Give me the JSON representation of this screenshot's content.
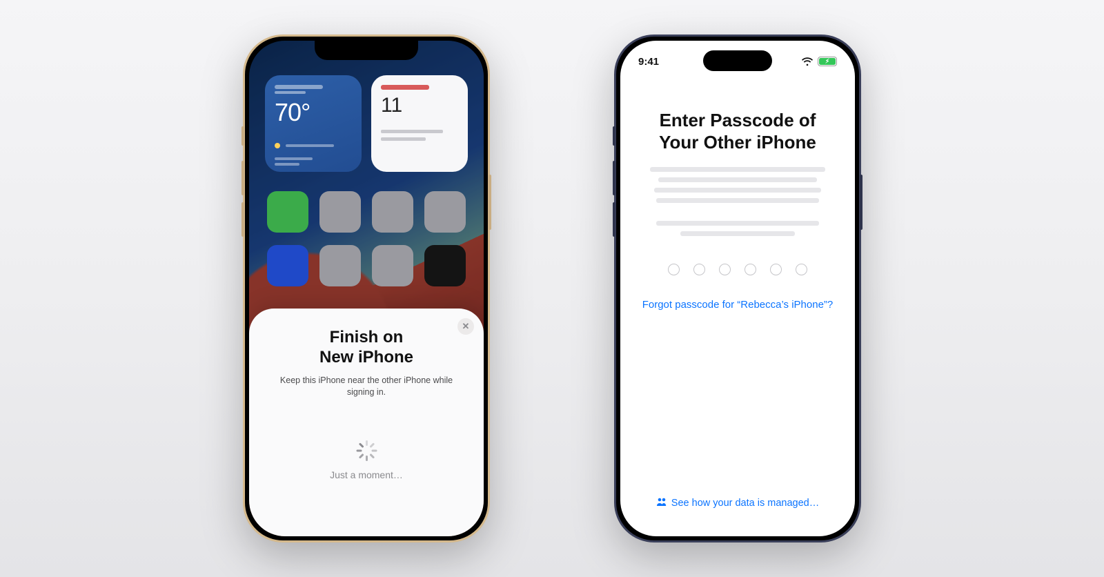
{
  "left_phone": {
    "weather": {
      "temperature": "70°"
    },
    "calendar": {
      "day": "11"
    },
    "app_colors": [
      "#3bab4a",
      "#9a9aa0",
      "#9a9aa0",
      "#9a9aa0",
      "#1f49c8",
      "#9a9aa0",
      "#9a9aa0",
      "#141414"
    ],
    "sheet": {
      "title_line1": "Finish on",
      "title_line2": "New iPhone",
      "description": "Keep this iPhone near the other iPhone while signing in.",
      "spinner_label": "Just a moment…",
      "close_glyph": "✕"
    }
  },
  "right_phone": {
    "status": {
      "time": "9:41"
    },
    "title_line1": "Enter Passcode of",
    "title_line2": "Your Other iPhone",
    "forgot_link": "Forgot passcode for “Rebecca’s iPhone”?",
    "data_link": "See how your data is managed…",
    "passcode_length": 6
  }
}
